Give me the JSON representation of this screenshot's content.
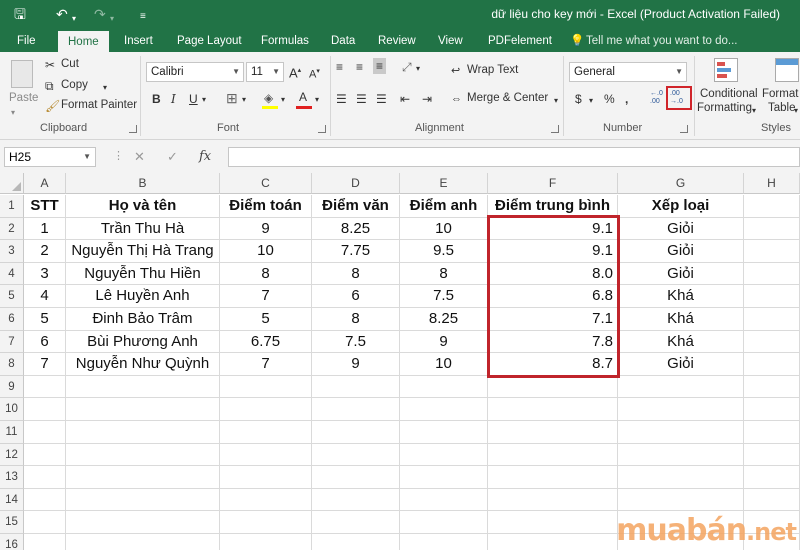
{
  "window": {
    "title": "dữ liệu cho key mới - Excel (Product Activation Failed)",
    "qat": {
      "save_icon": "save-icon",
      "undo_icon": "undo-icon",
      "redo_icon": "redo-icon",
      "customize_icon": "customize-qat-icon"
    }
  },
  "tabs": [
    {
      "label": "File"
    },
    {
      "label": "Home"
    },
    {
      "label": "Insert"
    },
    {
      "label": "Page Layout"
    },
    {
      "label": "Formulas"
    },
    {
      "label": "Data"
    },
    {
      "label": "Review"
    },
    {
      "label": "View"
    },
    {
      "label": "PDFelement"
    }
  ],
  "tell_me": "Tell me what you want to do...",
  "ribbon": {
    "clipboard": {
      "paste": "Paste",
      "cut": "Cut",
      "copy": "Copy",
      "format_painter": "Format Painter",
      "label": "Clipboard"
    },
    "font": {
      "name": "Calibri",
      "size": "11",
      "label": "Font"
    },
    "alignment": {
      "wrap_text": "Wrap Text",
      "merge_center": "Merge & Center",
      "label": "Alignment"
    },
    "number": {
      "format": "General",
      "label": "Number",
      "decrease_decimal_top": ".00",
      "decrease_decimal_bottom": "→.0",
      "increase_decimal_top": "←.0",
      "increase_decimal_bottom": ".00"
    },
    "styles": {
      "conditional_formatting_1": "Conditional",
      "conditional_formatting_2": "Formatting",
      "format_as_table_1": "Format a",
      "format_as_table_2": "Table",
      "label": "Styles"
    }
  },
  "formula_bar": {
    "name_box": "H25",
    "cancel": "✕",
    "enter": "✓",
    "fx": "fx",
    "value": ""
  },
  "sheet": {
    "columns": [
      "A",
      "B",
      "C",
      "D",
      "E",
      "F",
      "G",
      "H"
    ],
    "row_numbers": [
      "1",
      "2",
      "3",
      "4",
      "5",
      "6",
      "7",
      "8",
      "9",
      "10",
      "11",
      "12",
      "13",
      "14",
      "15",
      "16"
    ],
    "header_row": [
      "STT",
      "Họ và tên",
      "Điểm toán",
      "Điểm văn",
      "Điểm anh",
      "Điểm trung bình",
      "Xếp loại"
    ],
    "rows": [
      [
        "1",
        "Trần Thu Hà",
        "9",
        "8.25",
        "10",
        "9.1",
        "Giỏi"
      ],
      [
        "2",
        "Nguyễn Thị Hà Trang",
        "10",
        "7.75",
        "9.5",
        "9.1",
        "Giỏi"
      ],
      [
        "3",
        "Nguyễn Thu Hiền",
        "8",
        "8",
        "8",
        "8.0",
        "Giỏi"
      ],
      [
        "4",
        "Lê Huyền Anh",
        "7",
        "6",
        "7.5",
        "6.8",
        "Khá"
      ],
      [
        "5",
        "Đinh Bảo Trâm",
        "5",
        "8",
        "8.25",
        "7.1",
        "Khá"
      ],
      [
        "6",
        "Bùi Phương Anh",
        "6.75",
        "7.5",
        "9",
        "7.8",
        "Khá"
      ],
      [
        "7",
        "Nguyễn Như Quỳnh",
        "7",
        "9",
        "10",
        "8.7",
        "Giỏi"
      ]
    ]
  },
  "watermark": {
    "brand": "muabán",
    "tld": ".net"
  },
  "colors": {
    "excel_green": "#217346",
    "highlight_red": "#c0242b"
  }
}
